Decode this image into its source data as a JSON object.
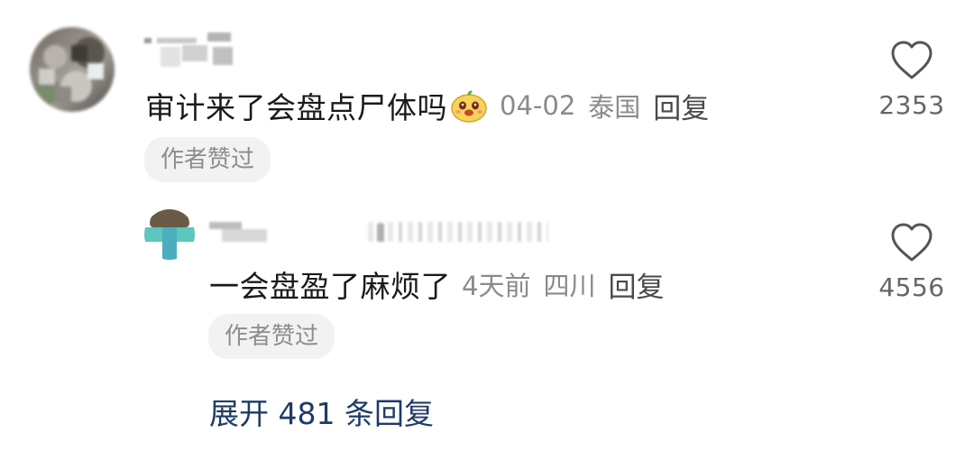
{
  "comments": [
    {
      "text": "审计来了会盘点尸体吗",
      "emoji": "mascot-emoji",
      "date": "04-02",
      "location": "泰国",
      "reply_label": "回复",
      "badge": "作者赞过",
      "likes": "2353"
    },
    {
      "text": "一会盘盈了麻烦了",
      "date": "4天前",
      "location": "四川",
      "reply_label": "回复",
      "badge": "作者赞过",
      "likes": "4556"
    }
  ],
  "expand_replies": "展开 481 条回复",
  "colors": {
    "link_blue": "#1f3b66",
    "meta_gray": "#8a8a8a",
    "badge_bg": "#f2f2f2"
  }
}
